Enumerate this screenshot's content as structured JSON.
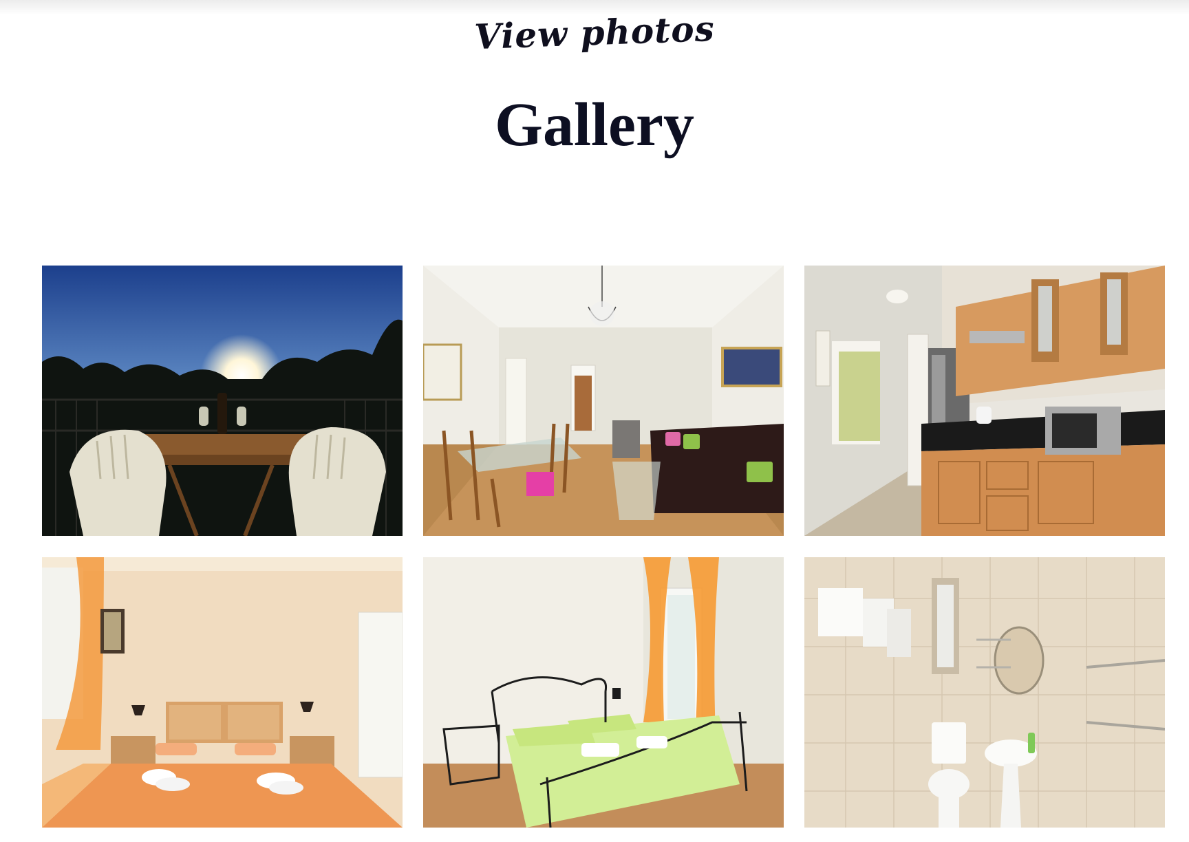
{
  "header": {
    "eyebrow": "View photos",
    "title": "Gallery"
  },
  "gallery": {
    "photos": [
      {
        "name": "balcony-photo",
        "subject": "balcony table and chairs at sunset"
      },
      {
        "name": "living-room-photo",
        "subject": "dining area and living room"
      },
      {
        "name": "kitchen-photo",
        "subject": "kitchen with wooden cabinets"
      },
      {
        "name": "bedroom-photo",
        "subject": "bedroom with orange bedspread"
      },
      {
        "name": "second-bedroom-photo",
        "subject": "bedroom with green bedspread and metal bed frame"
      },
      {
        "name": "bathroom-photo",
        "subject": "tiled bathroom with sink and toilet"
      }
    ]
  },
  "colors": {
    "text": "#0d0f22",
    "background": "#ffffff"
  }
}
